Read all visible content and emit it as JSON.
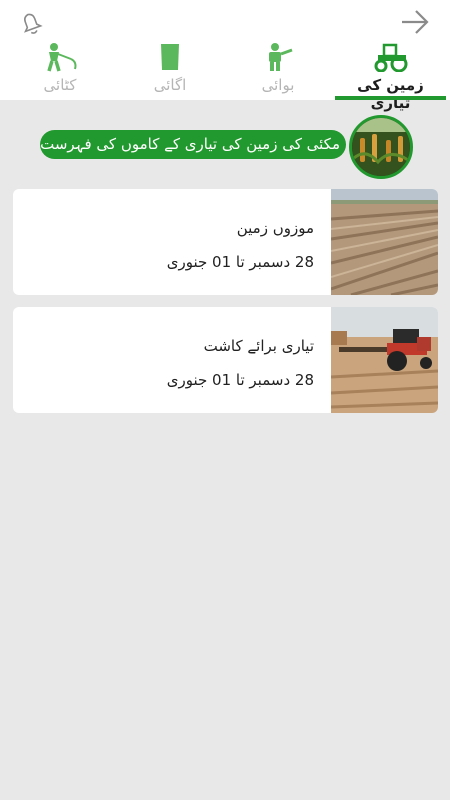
{
  "tabs": [
    {
      "label": "زمین کی تیاری",
      "icon": "tractor-icon",
      "active": true
    },
    {
      "label": "بوائی",
      "icon": "farmer-sowing-icon",
      "active": false
    },
    {
      "label": "اگائی",
      "icon": "seed-bag-icon",
      "active": false
    },
    {
      "label": "کٹائی",
      "icon": "farmer-harvest-icon",
      "active": false
    }
  ],
  "banner": {
    "text": "مکئی کی زمین کی تیاری کے کاموں کی فہرست"
  },
  "cards": [
    {
      "title": "موزوں زمین",
      "dates": "28 دسمبر تا 01 جنوری"
    },
    {
      "title": "تیاری برائے کاشت",
      "dates": "28 دسمبر تا 01 جنوری"
    }
  ],
  "colors": {
    "accent": "#22992e",
    "icon_inactive": "#5cb85c",
    "background": "#e8e8e8"
  }
}
